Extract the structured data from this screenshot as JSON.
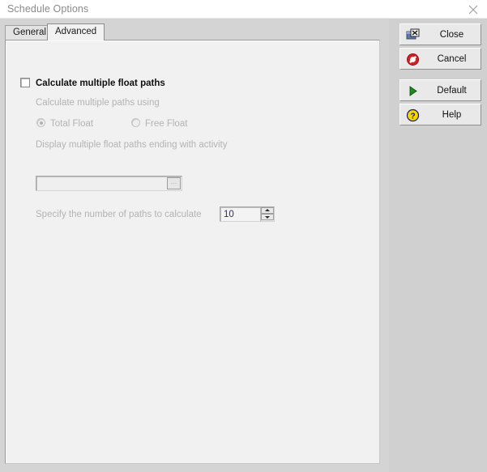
{
  "window": {
    "title": "Schedule Options",
    "close_icon": "close-x-icon"
  },
  "tabs": [
    {
      "label": "General",
      "active": false
    },
    {
      "label": "Advanced",
      "active": true
    }
  ],
  "form": {
    "calculate_multiple_float_paths": {
      "label": "Calculate multiple float paths",
      "checked": false
    },
    "calculate_using": {
      "label": "Calculate multiple paths using",
      "options": [
        {
          "label": "Total Float",
          "selected": true
        },
        {
          "label": "Free Float",
          "selected": false
        }
      ],
      "disabled": true
    },
    "display_ending_activity": {
      "label": "Display multiple float paths ending with activity",
      "value": "",
      "placeholder": "",
      "browse_label": "...",
      "disabled": true
    },
    "number_of_paths": {
      "label": "Specify the number of paths to calculate",
      "value": "10",
      "disabled": true
    }
  },
  "buttons": [
    {
      "label": "Close",
      "icon": "close-window-icon"
    },
    {
      "label": "Cancel",
      "icon": "cancel-prohibition-icon"
    },
    {
      "label": "Default",
      "icon": "play-triangle-icon"
    },
    {
      "label": "Help",
      "icon": "help-question-icon"
    }
  ],
  "colors": {
    "panel_background": "#d0d0d0",
    "content_background": "#f1f1f1",
    "disabled_text": "#b3b3b3",
    "cancel_red": "#d81f26",
    "default_green": "#1f8a1f",
    "help_yellow": "#f5d800",
    "spinner_value_blue": "#2d2d6a"
  }
}
